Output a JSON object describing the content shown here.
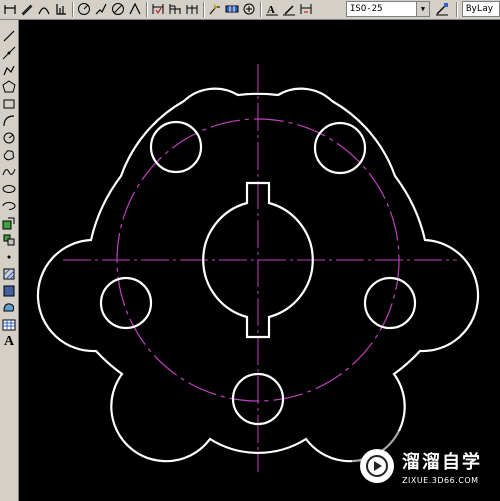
{
  "toolbar": {
    "dimstyle_value": "ISO-25",
    "layer_value": "ByLay"
  },
  "leftbar": {
    "text_tool": "A"
  },
  "watermark": {
    "title": "溜溜自学",
    "url": "ZIXUE.3D66.COM"
  },
  "colors": {
    "canvas_background": "#000000",
    "geometry": "#ffffff",
    "centerline": "#c040c0",
    "toolbar_face": "#d4d0c8"
  }
}
